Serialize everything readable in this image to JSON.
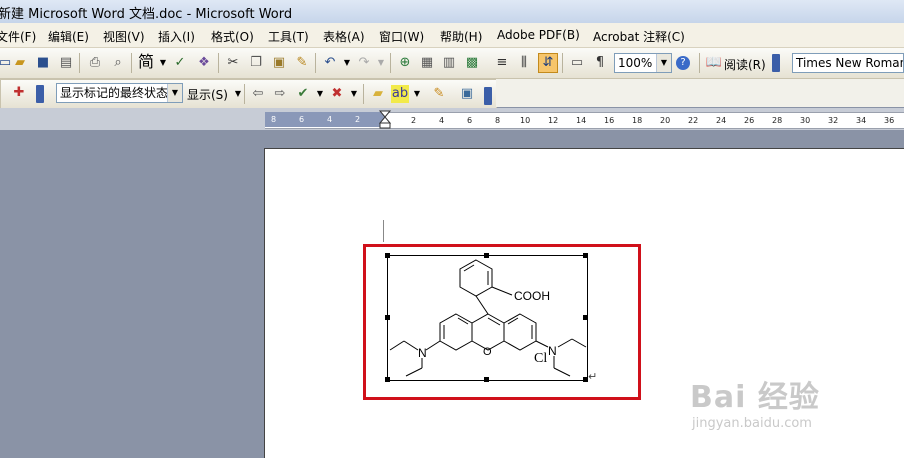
{
  "window": {
    "title": "新建 Microsoft Word 文档.doc - Microsoft Word"
  },
  "menubar": {
    "items": [
      "文件(F)",
      "编辑(E)",
      "视图(V)",
      "插入(I)",
      "格式(O)",
      "工具(T)",
      "表格(A)",
      "窗口(W)",
      "帮助(H)",
      "Adobe PDF(B)",
      "Acrobat 注释(C)"
    ]
  },
  "toolbar": {
    "simplified_label": "简",
    "zoom_value": "100%",
    "reading_label": "阅读(R)",
    "font_value": "Times New Roman"
  },
  "reviewing": {
    "display_state": "显示标记的最终状态",
    "show_label": "显示(S)"
  },
  "ruler": {
    "numbers": [
      "8",
      "6",
      "4",
      "2",
      "2",
      "4",
      "6",
      "8",
      "10",
      "12",
      "14",
      "16",
      "18",
      "20",
      "22",
      "24",
      "26",
      "28",
      "30",
      "32",
      "34",
      "36"
    ]
  },
  "document": {
    "molecule": {
      "cooh_label": "COOH",
      "n_left": "N",
      "n_right": "N",
      "o_label": "O",
      "cl_label": "Cl"
    },
    "paragraph_mark": "↵"
  },
  "watermark": {
    "main": "Bai 经验",
    "sub": "jingyan.baidu.com"
  },
  "colors": {
    "highlight": "#d0101a",
    "desktop": "#8a93a6"
  }
}
